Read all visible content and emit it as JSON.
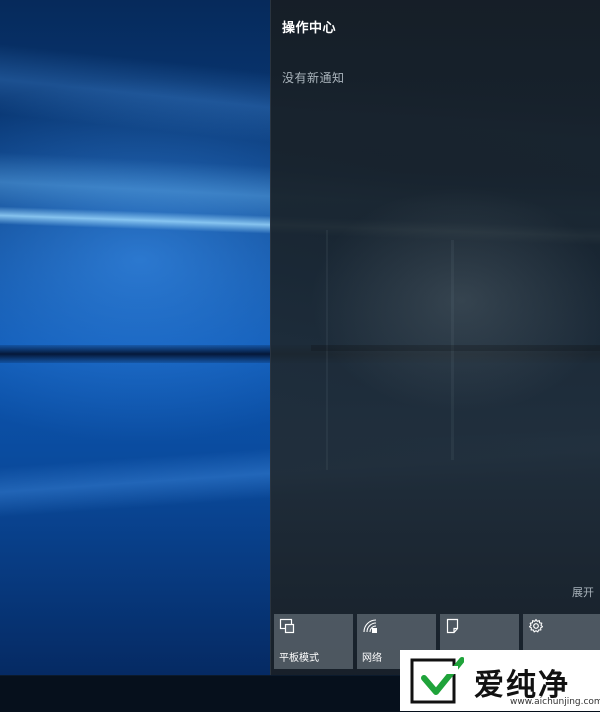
{
  "action_center": {
    "title": "操作中心",
    "empty_message": "没有新通知",
    "expand_label": "展开",
    "quick_actions": [
      {
        "label": "平板模式",
        "icon": "tablet-mode-icon"
      },
      {
        "label": "网络",
        "icon": "network-icon"
      },
      {
        "label": "",
        "icon": "note-icon"
      },
      {
        "label": "",
        "icon": "settings-gear-icon"
      }
    ]
  },
  "watermark": {
    "brand": "爱纯净",
    "url": "www.aichunjing.com"
  },
  "colors": {
    "wallpaper_blue": "#0c55b0",
    "panel_bg": "#1a242c",
    "tile_bg": "#5f6973",
    "taskbar": "#06101c",
    "logo_green": "#1fa33a"
  }
}
